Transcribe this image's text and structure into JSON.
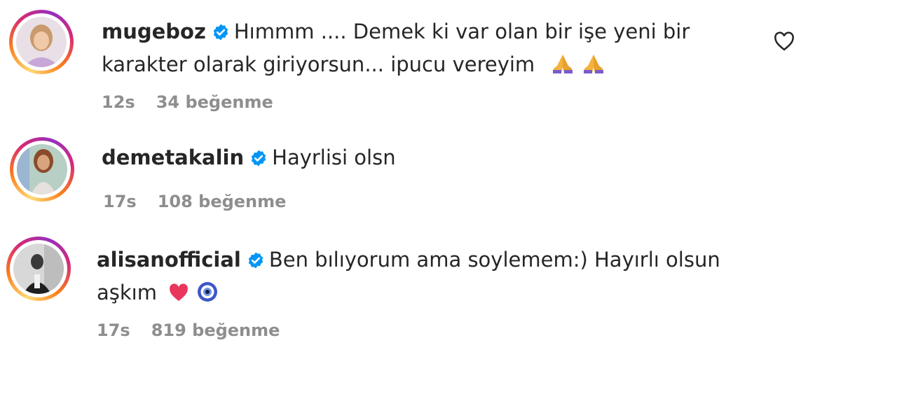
{
  "comments": [
    {
      "username": "mugeboz",
      "text_line1": "Hımmm .... Demek ki var olan bir işe yeni bir",
      "text_line2": "karakter olarak giriyorsun... ipucu vereyim",
      "emoji": [
        "folded-hands",
        "folded-hands"
      ],
      "time": "12s",
      "likes": "34 beğenme"
    },
    {
      "username": "demetakalin",
      "text_line1": "Hayrlisi olsn",
      "time": "17s",
      "likes": "108 beğenme"
    },
    {
      "username": "alisanofficial",
      "text_line1": "Ben bılıyorum ama soylemem:) Hayırlı olsun",
      "text_line2": "aşkım",
      "emoji": [
        "red-heart",
        "nazar-amulet"
      ],
      "time": "17s",
      "likes": "819 beğenme"
    }
  ],
  "colors": {
    "verified_blue": "#0095f6",
    "meta_gray": "#8e8e8e",
    "text": "#262626"
  }
}
